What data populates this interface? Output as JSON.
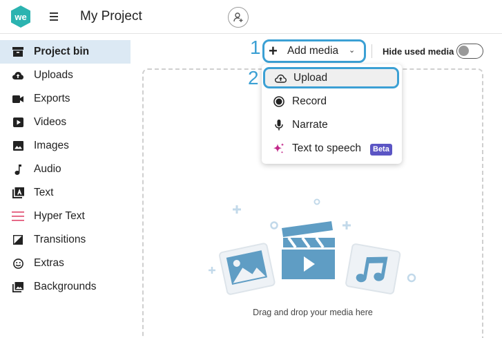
{
  "header": {
    "logo_text": "we",
    "project_title": "My Project"
  },
  "sidebar": {
    "items": [
      {
        "label": "Project bin",
        "icon": "archive-icon",
        "active": true
      },
      {
        "label": "Uploads",
        "icon": "cloud-upload-icon"
      },
      {
        "label": "Exports",
        "icon": "video-camera-icon"
      },
      {
        "label": "Videos",
        "icon": "play-icon"
      },
      {
        "label": "Images",
        "icon": "image-icon"
      },
      {
        "label": "Audio",
        "icon": "music-note-icon"
      },
      {
        "label": "Text",
        "icon": "text-icon"
      },
      {
        "label": "Hyper Text",
        "icon": "hyper-text-icon"
      },
      {
        "label": "Transitions",
        "icon": "transition-icon"
      },
      {
        "label": "Extras",
        "icon": "smiley-icon"
      },
      {
        "label": "Backgrounds",
        "icon": "backgrounds-icon"
      }
    ]
  },
  "toolbar": {
    "step1": "1",
    "step2": "2",
    "add_media_label": "Add media",
    "hide_used_label": "Hide used media",
    "hide_used_on": false
  },
  "dropdown": {
    "items": [
      {
        "label": "Upload",
        "icon": "cloud-upload-icon",
        "highlighted": true
      },
      {
        "label": "Record",
        "icon": "record-icon"
      },
      {
        "label": "Narrate",
        "icon": "microphone-icon"
      },
      {
        "label": "Text to speech",
        "icon": "sparkle-icon",
        "badge": "Beta"
      }
    ]
  },
  "dropzone": {
    "text": "Drag and drop your media here"
  },
  "colors": {
    "accent": "#3ba0d4",
    "active_bg": "#dce9f4",
    "logo": "#2bb3b0",
    "beta": "#5b55c4",
    "hyper_text": "#e0456a",
    "sparkle": "#c2288a"
  }
}
